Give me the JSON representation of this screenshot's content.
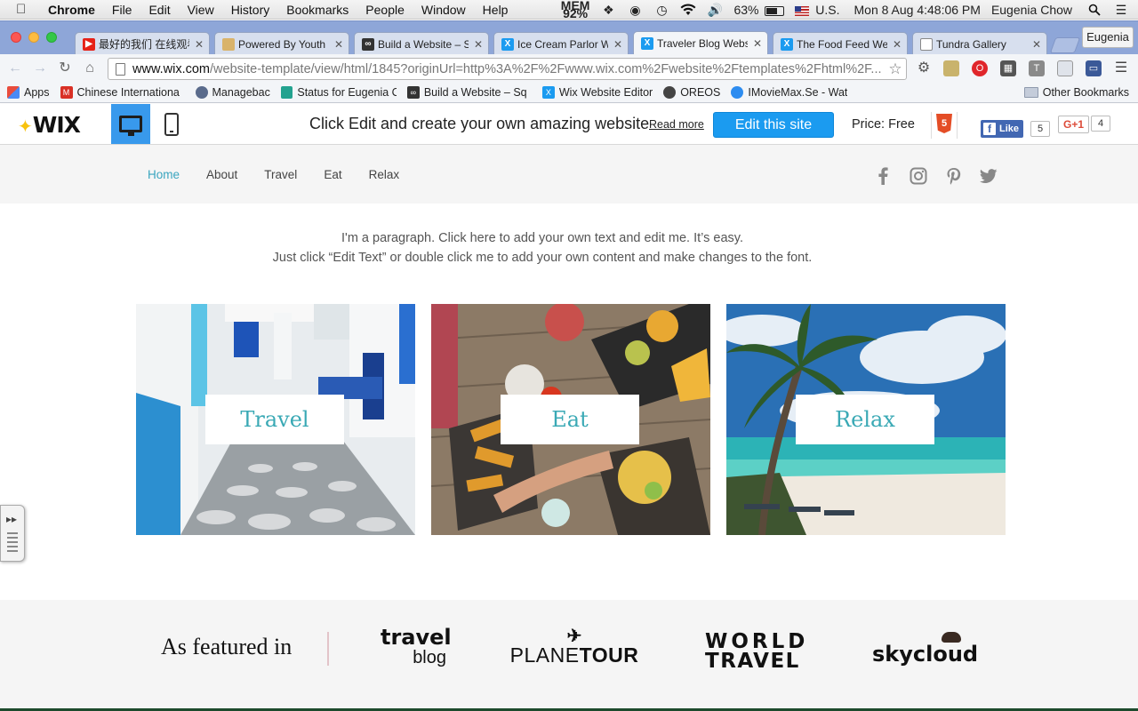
{
  "menubar": {
    "app": "Chrome",
    "items": [
      "File",
      "Edit",
      "View",
      "History",
      "Bookmarks",
      "People",
      "Window",
      "Help"
    ],
    "mem_label": "MEM",
    "mem_value": "92%",
    "battery": "63%",
    "battery_level": 0.63,
    "input_source": "U.S.",
    "clock": "Mon 8 Aug  4:48:06 PM",
    "user": "Eugenia Chow"
  },
  "tabs": [
    {
      "title": "最好的我们 在线观看",
      "icon": "youtube-icon",
      "color": "#e62117",
      "active": false
    },
    {
      "title": "Powered By Youth F",
      "icon": "page-icon",
      "color": "#d9b36a",
      "active": false
    },
    {
      "title": "Build a Website – Sq",
      "icon": "squarespace-icon",
      "color": "#333333",
      "active": false
    },
    {
      "title": "Ice Cream Parlor We",
      "icon": "wix-icon",
      "color": "#1b9bf0",
      "active": false
    },
    {
      "title": "Traveler Blog Websi",
      "icon": "wix-icon",
      "color": "#1b9bf0",
      "active": true
    },
    {
      "title": "The Food Feed Web",
      "icon": "wix-icon",
      "color": "#1b9bf0",
      "active": false
    },
    {
      "title": "Tundra Gallery",
      "icon": "document-icon",
      "color": "#888888",
      "active": false
    }
  ],
  "profile_button": "Eugenia",
  "omnibox": {
    "domain": "www.wix.com",
    "path": "/website-template/view/html/1845?originUrl=http%3A%2F%2Fwww.wix.com%2Fwebsite%2Ftemplates%2Fhtml%2F..."
  },
  "bookmarks": [
    {
      "label": "Apps",
      "icon": "apps-grid-icon",
      "color": "#e84c3d"
    },
    {
      "label": "Chinese Internationa",
      "icon": "gmail-icon",
      "color": "#d93025"
    },
    {
      "label": "Managebac",
      "icon": "managebac-icon",
      "color": "#5a6b8c"
    },
    {
      "label": "Status for Eugenia C",
      "icon": "status-icon",
      "color": "#23a28f"
    },
    {
      "label": "Build a Website – Sq",
      "icon": "squarespace-icon",
      "color": "#333333"
    },
    {
      "label": "Wix Website Editor",
      "icon": "wix-icon",
      "color": "#1b9bf0"
    },
    {
      "label": "OREOS",
      "icon": "oreo-icon",
      "color": "#444444"
    },
    {
      "label": "IMovieMax.Se - Wat",
      "icon": "globe-icon",
      "color": "#2d8cf0"
    }
  ],
  "other_bookmarks": "Other Bookmarks",
  "wixbar": {
    "logo": "WIX",
    "cta": "Click Edit and create your own amazing website",
    "read_more": "Read more",
    "edit_button": "Edit this site",
    "price": "Price: Free",
    "html5": "5",
    "fb_like": "Like",
    "fb_count": "5",
    "gplus": "G+1",
    "gplus_count": "4"
  },
  "site": {
    "nav": [
      "Home",
      "About",
      "Travel",
      "Eat",
      "Relax"
    ],
    "active_nav": "Home",
    "social": [
      "facebook-icon",
      "instagram-icon",
      "pinterest-icon",
      "twitter-icon"
    ],
    "intro_line1": "I'm a paragraph. Click here to add your own text and edit me. It’s easy.",
    "intro_line2": "Just click “Edit Text” or double click me to add your own content and make changes to the font.",
    "cards": [
      "Travel",
      "Eat",
      "Relax"
    ],
    "accent_color": "#3aa9b5",
    "featured_in": "As featured in",
    "brands": {
      "travel_blog_top": "travel",
      "travel_blog_bottom": "blog",
      "planetour_a": "PLANE",
      "planetour_b": "TOUR",
      "world": "WORLD",
      "travel": "TRAVEL",
      "skycloud": "skycloud"
    }
  }
}
